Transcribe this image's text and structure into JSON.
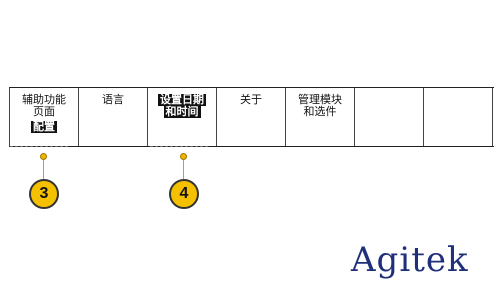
{
  "menu": {
    "items": [
      {
        "lines": [
          "辅助功能",
          "页面"
        ],
        "highlight": "配置"
      },
      {
        "lines": [
          "语言"
        ],
        "highlight": ""
      },
      {
        "lines": [],
        "highlight_lines": [
          "设置日期",
          "和时间"
        ]
      },
      {
        "lines": [
          "关于"
        ],
        "highlight": ""
      },
      {
        "lines": [
          "管理模块",
          "和选件"
        ],
        "highlight": ""
      },
      {
        "lines": [],
        "highlight": ""
      },
      {
        "lines": [],
        "highlight": ""
      }
    ]
  },
  "callouts": [
    {
      "label": "3"
    },
    {
      "label": "4"
    }
  ],
  "watermark": "Agitek",
  "colors": {
    "callout_fill": "#f5c000",
    "highlight_bg": "#111111",
    "watermark": "#1f2f7a"
  }
}
